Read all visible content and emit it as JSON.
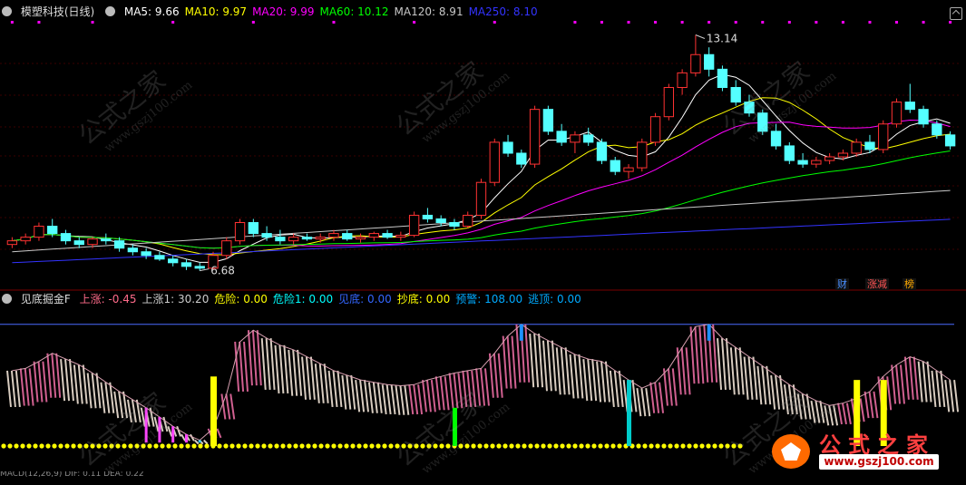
{
  "main_legend": {
    "title": "模塑科技(日线)",
    "items": [
      {
        "label": "MA5: 9.66",
        "color": "#ffffff"
      },
      {
        "label": "MA10: 9.97",
        "color": "#ffff00"
      },
      {
        "label": "MA20: 9.99",
        "color": "#ff00ff"
      },
      {
        "label": "MA60: 10.12",
        "color": "#00ff00"
      },
      {
        "label": "MA120: 8.91",
        "color": "#c8c8c8"
      },
      {
        "label": "MA250: 8.10",
        "color": "#3333ff"
      }
    ]
  },
  "indicator_legend": {
    "title": "见底掘金F",
    "items": [
      {
        "label": "上涨: -0.45",
        "color": "#ff6b8a"
      },
      {
        "label": "上涨1: 30.20",
        "color": "#cccccc"
      },
      {
        "label": "危险: 0.00",
        "color": "#ffff00"
      },
      {
        "label": "危险1: 0.00",
        "color": "#00ffff"
      },
      {
        "label": "见底: 0.00",
        "color": "#3366ff"
      },
      {
        "label": "抄底: 0.00",
        "color": "#ffff00"
      },
      {
        "label": "预警: 108.00",
        "color": "#00aaff"
      },
      {
        "label": "逃顶: 0.00",
        "color": "#00aaff"
      }
    ]
  },
  "tags": [
    {
      "label": "财",
      "color": "#4a90ff"
    },
    {
      "label": "涨减",
      "color": "#ff5555"
    },
    {
      "label": "榜",
      "color": "#ffaa00"
    }
  ],
  "watermarks": [
    {
      "text": "公式之家",
      "sub": "www.gszj100.com"
    },
    {
      "text": "公式之家",
      "sub": "www.gszj100.com"
    },
    {
      "text": "公式之家",
      "sub": "www.gszj100.com"
    },
    {
      "text": "公式之家",
      "sub": "www.gszj100.com"
    },
    {
      "text": "公式之家",
      "sub": "www.gszj100.com"
    },
    {
      "text": "公式之家",
      "sub": "www.gszj100.com"
    }
  ],
  "logo": {
    "text": "公式之家",
    "url": "www.gszj100.com"
  },
  "bottom_strip": "MACD(12,26,9) DIF: 0.11  DEA: 0.22",
  "chart_data": {
    "type": "candlestick",
    "title": "模塑科技(日线)",
    "price_annotations": [
      {
        "label": "13.14",
        "value": 13.14,
        "kind": "high"
      },
      {
        "label": "6.68",
        "value": 6.68,
        "kind": "low"
      }
    ],
    "price_range": [
      6.2,
      13.5
    ],
    "candles": [
      [
        7.4,
        7.6,
        7.3,
        7.5
      ],
      [
        7.5,
        7.7,
        7.4,
        7.6
      ],
      [
        7.6,
        8.0,
        7.5,
        7.9
      ],
      [
        7.9,
        8.1,
        7.6,
        7.7
      ],
      [
        7.7,
        7.8,
        7.4,
        7.5
      ],
      [
        7.5,
        7.6,
        7.3,
        7.4
      ],
      [
        7.4,
        7.6,
        7.3,
        7.55
      ],
      [
        7.55,
        7.7,
        7.4,
        7.5
      ],
      [
        7.5,
        7.6,
        7.2,
        7.3
      ],
      [
        7.3,
        7.4,
        7.1,
        7.2
      ],
      [
        7.2,
        7.3,
        7.0,
        7.1
      ],
      [
        7.1,
        7.2,
        6.95,
        7.0
      ],
      [
        7.0,
        7.1,
        6.8,
        6.9
      ],
      [
        6.9,
        7.0,
        6.7,
        6.8
      ],
      [
        6.8,
        6.9,
        6.68,
        6.75
      ],
      [
        6.75,
        7.2,
        6.7,
        7.1
      ],
      [
        7.1,
        7.6,
        7.0,
        7.5
      ],
      [
        7.5,
        8.1,
        7.4,
        8.0
      ],
      [
        8.0,
        8.1,
        7.6,
        7.7
      ],
      [
        7.7,
        7.9,
        7.5,
        7.6
      ],
      [
        7.6,
        7.8,
        7.4,
        7.5
      ],
      [
        7.5,
        7.7,
        7.4,
        7.6
      ],
      [
        7.6,
        7.7,
        7.5,
        7.55
      ],
      [
        7.55,
        7.7,
        7.45,
        7.6
      ],
      [
        7.6,
        7.8,
        7.5,
        7.7
      ],
      [
        7.7,
        7.8,
        7.5,
        7.55
      ],
      [
        7.55,
        7.7,
        7.45,
        7.6
      ],
      [
        7.6,
        7.75,
        7.5,
        7.7
      ],
      [
        7.7,
        7.8,
        7.55,
        7.6
      ],
      [
        7.6,
        7.75,
        7.5,
        7.65
      ],
      [
        7.65,
        8.3,
        7.6,
        8.2
      ],
      [
        8.2,
        8.4,
        8.0,
        8.1
      ],
      [
        8.1,
        8.2,
        7.9,
        8.0
      ],
      [
        8.0,
        8.1,
        7.8,
        7.9
      ],
      [
        7.9,
        8.3,
        7.85,
        8.2
      ],
      [
        8.2,
        9.2,
        8.1,
        9.1
      ],
      [
        9.1,
        10.3,
        9.0,
        10.2
      ],
      [
        10.2,
        10.4,
        9.8,
        9.9
      ],
      [
        9.9,
        10.0,
        9.5,
        9.6
      ],
      [
        9.6,
        11.2,
        9.5,
        11.1
      ],
      [
        11.1,
        11.2,
        10.4,
        10.5
      ],
      [
        10.5,
        10.7,
        10.1,
        10.2
      ],
      [
        10.2,
        10.5,
        9.9,
        10.4
      ],
      [
        10.4,
        10.6,
        10.1,
        10.2
      ],
      [
        10.2,
        10.3,
        9.6,
        9.7
      ],
      [
        9.7,
        9.8,
        9.3,
        9.4
      ],
      [
        9.4,
        9.6,
        9.2,
        9.5
      ],
      [
        9.5,
        10.3,
        9.4,
        10.2
      ],
      [
        10.2,
        11.0,
        10.1,
        10.9
      ],
      [
        10.9,
        11.8,
        10.8,
        11.7
      ],
      [
        11.7,
        12.2,
        11.5,
        12.1
      ],
      [
        12.1,
        13.14,
        12.0,
        12.6
      ],
      [
        12.6,
        12.8,
        12.0,
        12.2
      ],
      [
        12.2,
        12.3,
        11.6,
        11.7
      ],
      [
        11.7,
        11.9,
        11.2,
        11.3
      ],
      [
        11.3,
        11.5,
        10.9,
        11.0
      ],
      [
        11.0,
        11.1,
        10.4,
        10.5
      ],
      [
        10.5,
        10.7,
        10.0,
        10.1
      ],
      [
        10.1,
        10.2,
        9.6,
        9.7
      ],
      [
        9.7,
        9.9,
        9.5,
        9.6
      ],
      [
        9.6,
        9.8,
        9.5,
        9.7
      ],
      [
        9.7,
        9.9,
        9.6,
        9.8
      ],
      [
        9.8,
        10.0,
        9.7,
        9.9
      ],
      [
        9.9,
        10.3,
        9.8,
        10.2
      ],
      [
        10.2,
        10.4,
        9.9,
        10.0
      ],
      [
        10.0,
        10.8,
        9.9,
        10.7
      ],
      [
        10.7,
        11.4,
        10.6,
        11.3
      ],
      [
        11.3,
        11.8,
        11.0,
        11.1
      ],
      [
        11.1,
        11.2,
        10.6,
        10.7
      ],
      [
        10.7,
        10.8,
        10.3,
        10.4
      ],
      [
        10.4,
        10.5,
        10.0,
        10.1
      ]
    ],
    "ma_series": [
      {
        "name": "MA5",
        "color": "#ffffff",
        "value": 9.66
      },
      {
        "name": "MA10",
        "color": "#ffff00",
        "value": 9.97
      },
      {
        "name": "MA20",
        "color": "#ff00ff",
        "value": 9.99
      },
      {
        "name": "MA60",
        "color": "#00ff00",
        "value": 10.12
      },
      {
        "name": "MA120",
        "color": "#c8c8c8",
        "value": 8.91
      },
      {
        "name": "MA250",
        "color": "#3333ff",
        "value": 8.1
      }
    ],
    "indicator": {
      "name": "见底掘金F",
      "range": [
        -5,
        110
      ],
      "reference_line": 100,
      "oscillator": [
        60,
        62,
        68,
        75,
        70,
        65,
        58,
        50,
        42,
        35,
        28,
        20,
        12,
        5,
        0,
        10,
        40,
        85,
        95,
        88,
        82,
        78,
        72,
        66,
        60,
        56,
        52,
        50,
        48,
        47,
        48,
        52,
        55,
        58,
        60,
        62,
        75,
        90,
        100,
        92,
        86,
        80,
        74,
        70,
        68,
        60,
        52,
        45,
        50,
        62,
        80,
        98,
        100,
        88,
        80,
        72,
        64,
        56,
        48,
        40,
        34,
        30,
        32,
        36,
        42,
        55,
        65,
        72,
        68,
        60,
        52
      ],
      "danger_bars": [
        {
          "index": 15,
          "value": 55,
          "color": "#ffff00"
        },
        {
          "index": 63,
          "value": 52,
          "color": "#ffff00"
        },
        {
          "index": 65,
          "value": 52,
          "color": "#ffff00"
        }
      ],
      "warning_bars": [
        {
          "index": 33,
          "value": 28,
          "color": "#00ff00"
        },
        {
          "index": 46,
          "value": 28,
          "color": "#00ff00"
        },
        {
          "index": 46,
          "value": 52,
          "color": "#00cccc"
        }
      ]
    }
  }
}
